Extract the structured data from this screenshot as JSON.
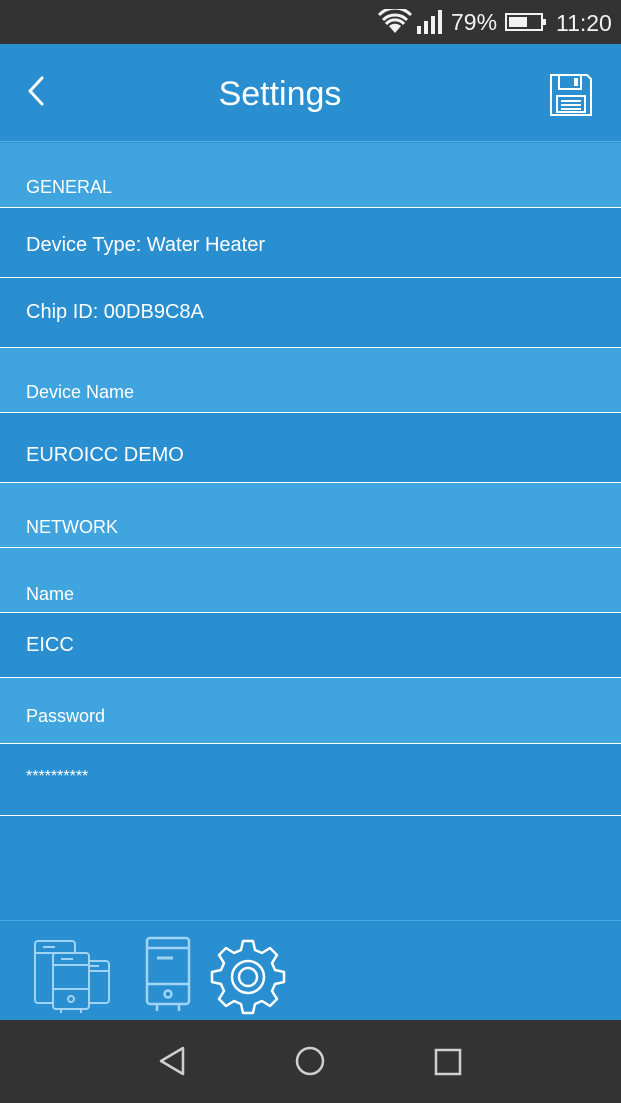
{
  "status_bar": {
    "battery_percent": "79%",
    "time": "11:20",
    "icons": [
      "wifi-icon",
      "signal-icon",
      "battery-icon"
    ]
  },
  "app_bar": {
    "title": "Settings",
    "back_icon": "chevron-left-icon",
    "save_icon": "floppy-disk-icon"
  },
  "general": {
    "section_label": "GENERAL",
    "device_type": "Device Type: Water Heater",
    "chip_id": "Chip ID: 00DB9C8A",
    "device_name_label": "Device Name",
    "device_name_value": "EUROICC DEMO"
  },
  "network": {
    "section_label": "NETWORK",
    "name_label": "Name",
    "name_value": "EICC",
    "password_label": "Password",
    "password_value": "**********"
  },
  "bottom_tabs": {
    "icons": [
      "multiple-devices-icon",
      "water-heater-icon",
      "gear-icon"
    ]
  },
  "system_nav": {
    "icons": [
      "back-triangle-icon",
      "home-circle-icon",
      "recents-square-icon"
    ]
  },
  "colors": {
    "primary": "#2a8fd0",
    "header_row": "#40a4de",
    "status_bar": "#333333",
    "icon_light": "#9fd4f5"
  }
}
